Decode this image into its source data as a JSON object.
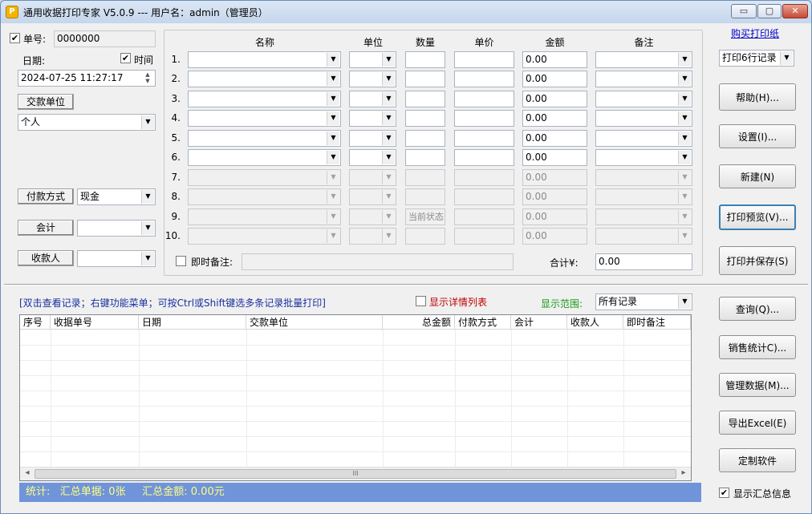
{
  "window": {
    "title": "通用收据打印专家 V5.0.9 --- 用户名：admin（管理员）",
    "app_icon": "P",
    "min_label": "▭",
    "max_label": "▢",
    "close_label": "✕"
  },
  "form": {
    "receipt_no_label": "单号:",
    "receipt_no_value": "0000000",
    "date_label": "日期:",
    "time_label": "时间",
    "datetime_value": "2024-07-25 11:27:17",
    "payer_button": "交款单位",
    "payer_value": "个人",
    "payment_method_button": "付款方式",
    "payment_method_value": "现金",
    "accountant_button": "会计",
    "accountant_value": "",
    "receiver_button": "收款人",
    "receiver_value": ""
  },
  "items": {
    "headers": [
      "名称",
      "单位",
      "数量",
      "单价",
      "金额",
      "备注"
    ],
    "rows": [
      {
        "num": "1.",
        "amount": "0.00"
      },
      {
        "num": "2.",
        "amount": "0.00"
      },
      {
        "num": "3.",
        "amount": "0.00"
      },
      {
        "num": "4.",
        "amount": "0.00"
      },
      {
        "num": "5.",
        "amount": "0.00"
      },
      {
        "num": "6.",
        "amount": "0.00"
      },
      {
        "num": "7.",
        "amount": "0.00"
      },
      {
        "num": "8.",
        "amount": "0.00"
      },
      {
        "num": "9.",
        "amount": "0.00",
        "qty": "当前状态"
      },
      {
        "num": "10.",
        "amount": "0.00"
      }
    ],
    "memo_label": "即时备注:",
    "total_label": "合计¥:",
    "total_value": "0.00"
  },
  "right_panel": {
    "buy_link": "购买打印纸",
    "print_rows_value": "打印6行记录",
    "help": "帮助(H)...",
    "settings": "设置(I)...",
    "new": "新建(N)",
    "preview": "打印预览(V)...",
    "print_save": "打印并保存(S)"
  },
  "records": {
    "hint": "[双击查看记录；右键功能菜单；可按Ctrl或Shift键选多条记录批量打印]",
    "detail_label": "显示详情列表",
    "range_label": "显示范围:",
    "range_value": "所有记录",
    "columns": [
      "序号",
      "收据单号",
      "日期",
      "交款单位",
      "总金额",
      "付款方式",
      "会计",
      "收款人",
      "即时备注"
    ],
    "scroll_left": "◂",
    "scroll_right": "▸",
    "scroll_grip": "III",
    "query": "查询(Q)...",
    "sales_stats": "销售统计C)...",
    "manage_data": "管理数据(M)...",
    "export_excel": "导出Excel(E)",
    "customize": "定制软件",
    "status_prefix": "统计:",
    "status_count": "汇总单据: 0张",
    "status_amount": "汇总金额: 0.00元",
    "show_summary": "显示汇总信息"
  },
  "colors": {
    "status_bg": "#6f94d9",
    "status_fg": "#ffff80",
    "link": "#0000cc",
    "detail_red": "#c00000",
    "range_green": "#1a9a1a"
  }
}
